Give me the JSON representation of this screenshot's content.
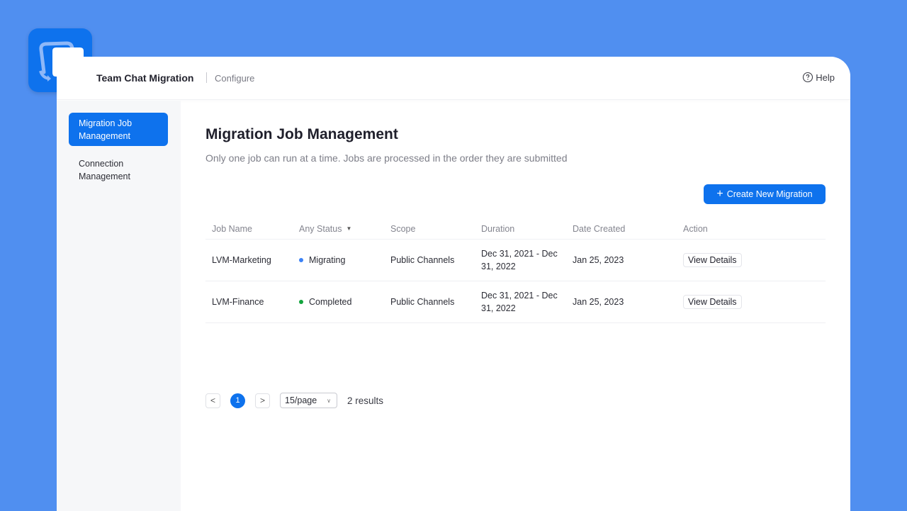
{
  "app": {
    "title": "Team Chat Migration",
    "section": "Configure",
    "help_label": "Help",
    "logo_icon": "chat-bubbles-icon"
  },
  "sidebar": {
    "items": [
      {
        "label": "Migration Job Management",
        "active": true
      },
      {
        "label": "Connection Management",
        "active": false
      }
    ]
  },
  "main": {
    "title": "Migration Job Management",
    "subtitle": "Only one job can run at a time. Jobs are processed in the order they are submitted",
    "create_button": {
      "icon": "+",
      "label": "Create New Migration"
    }
  },
  "table": {
    "columns": [
      "Job Name",
      "Any Status",
      "Scope",
      "Duration",
      "Date Created",
      "Action"
    ],
    "rows": [
      {
        "job_name": "LVM-Marketing",
        "status": "Migrating",
        "status_color": "#3b82f6",
        "scope": "Public Channels",
        "duration": "Dec 31, 2021 - Dec 31, 2022",
        "date_created": "Jan 25, 2023",
        "action": "View Details"
      },
      {
        "job_name": "LVM-Finance",
        "status": "Completed",
        "status_color": "#12a43d",
        "scope": "Public Channels",
        "duration": "Dec 31, 2021 - Dec 31, 2022",
        "date_created": "Jan 25, 2023",
        "action": "View Details"
      }
    ]
  },
  "pagination": {
    "prev": "<",
    "current_page": "1",
    "next": ">",
    "per_page": "15/page",
    "results": "2 results"
  },
  "colors": {
    "background": "#508ff0",
    "accent": "#0e72ed"
  }
}
